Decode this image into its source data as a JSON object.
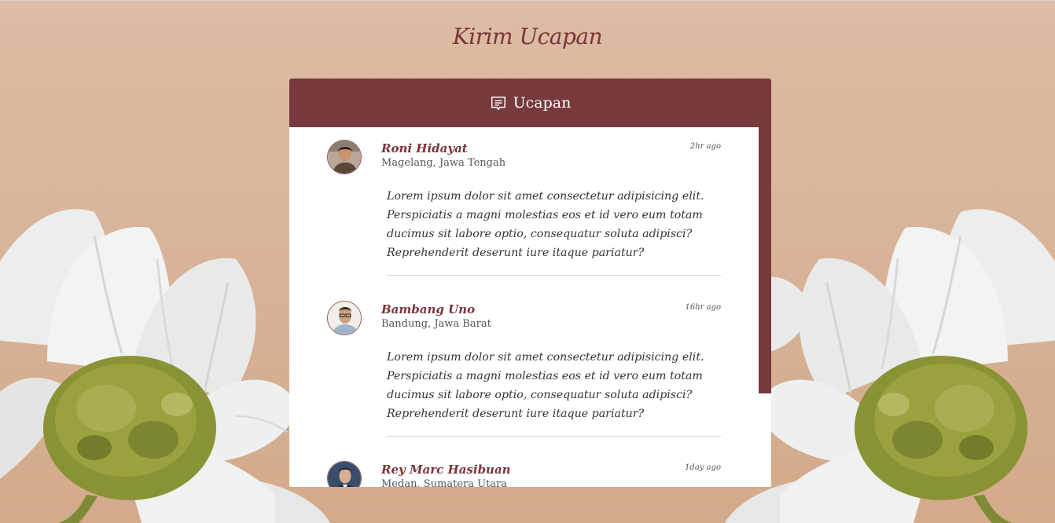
{
  "page": {
    "title": "Kirim Ucapan"
  },
  "panel": {
    "header_label": "Ucapan",
    "header_icon": "message-icon"
  },
  "comments": [
    {
      "name": "Roni Hidayat",
      "location": "Magelang, Jawa Tengah",
      "time": "2hr ago",
      "text": "Lorem ipsum dolor sit amet consectetur adipisicing elit. Perspiciatis a magni molestias eos et id vero eum totam ducimus sit labore optio, consequatur soluta adipisci? Reprehenderit deserunt iure itaque pariatur?"
    },
    {
      "name": "Bambang Uno",
      "location": "Bandung, Jawa Barat",
      "time": "16hr ago",
      "text": "Lorem ipsum dolor sit amet consectetur adipisicing elit. Perspiciatis a magni molestias eos et id vero eum totam ducimus sit labore optio, consequatur soluta adipisci? Reprehenderit deserunt iure itaque pariatur?"
    },
    {
      "name": "Rey Marc Hasibuan",
      "location": "Medan, Sumatera Utara",
      "time": "1day ago",
      "text": ""
    }
  ],
  "colors": {
    "accent": "#773a3c",
    "background": "#d7b297",
    "name_text": "#7a3438"
  }
}
